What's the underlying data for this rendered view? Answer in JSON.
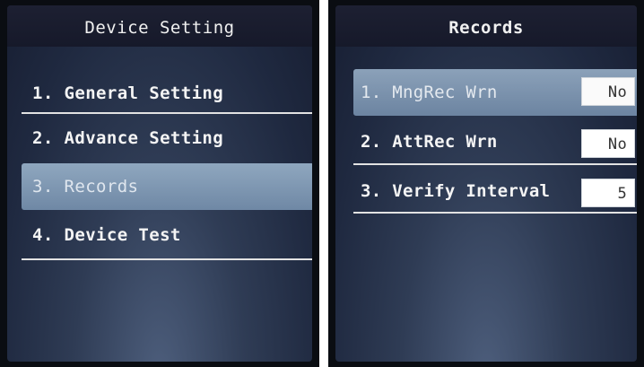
{
  "left_screen": {
    "title": "Device Setting",
    "menu_items": [
      {
        "label": "1. General Setting"
      },
      {
        "label": "2. Advance Setting"
      },
      {
        "label": "3. Records",
        "selected": true
      },
      {
        "label": "4. Device Test"
      }
    ]
  },
  "right_screen": {
    "title": "Records",
    "items": [
      {
        "label": "1. MngRec Wrn",
        "value": "No",
        "selected": true
      },
      {
        "label": "2. AttRec Wrn",
        "value": "No"
      },
      {
        "label": "3. Verify Interval",
        "value": "5"
      }
    ]
  }
}
